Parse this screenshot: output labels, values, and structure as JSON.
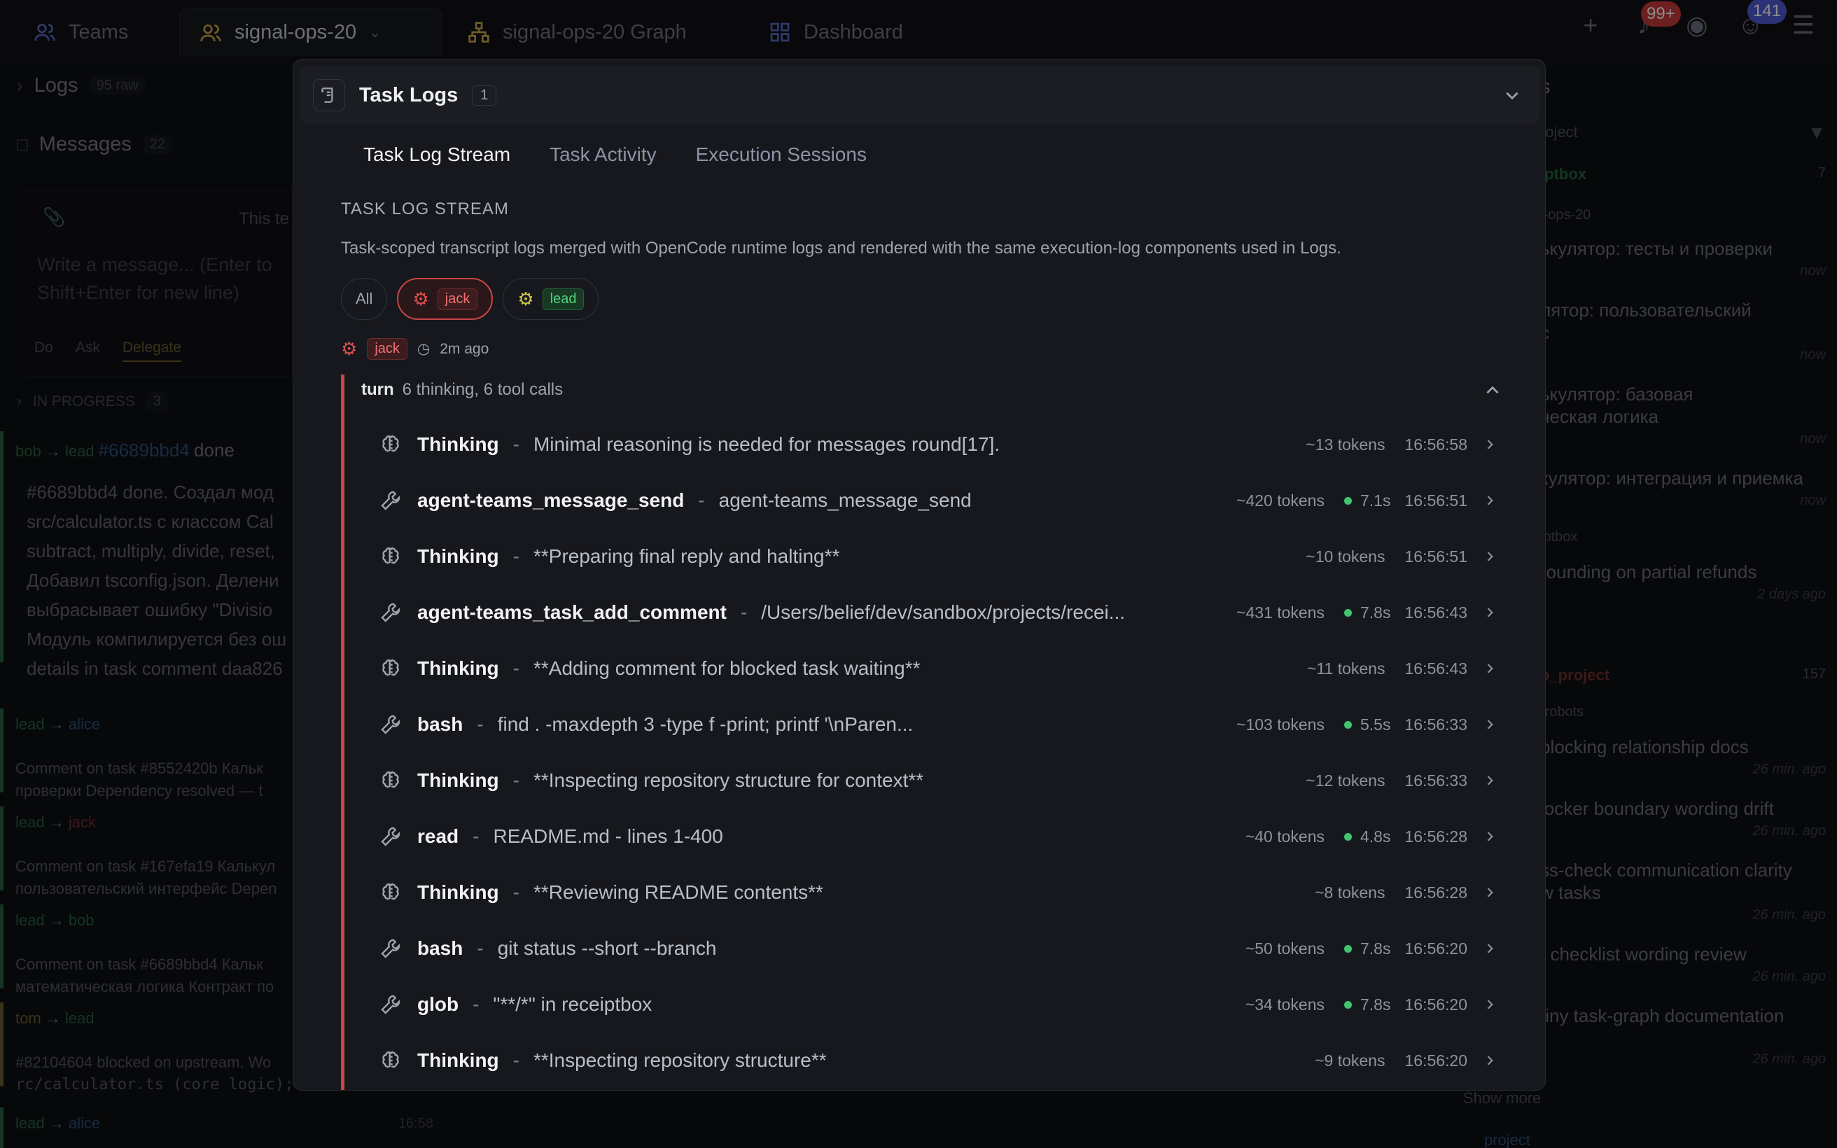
{
  "topbar": {
    "tabs": [
      {
        "label": "Teams",
        "icon": "users-icon"
      },
      {
        "label": "signal-ops-20",
        "icon": "users-icon"
      },
      {
        "label": "signal-ops-20 Graph",
        "icon": "graph-icon"
      },
      {
        "label": "Dashboard",
        "icon": "dashboard-icon"
      }
    ],
    "notifications_badge": "99+",
    "discord_badge": "141"
  },
  "left": {
    "logs_label": "Logs",
    "logs_count": "95 raw",
    "messages_label": "Messages",
    "messages_count": "22",
    "composer_placeholder": "Write a message... (Enter to",
    "composer_placeholder2": "Shift+Enter for new line)",
    "composer_note": "This te",
    "modes": [
      "Do",
      "Ask",
      "Delegate"
    ],
    "in_progress_label": "IN PROGRESS",
    "in_progress_count": "3",
    "feed": [
      {
        "from": "bob",
        "to": "lead",
        "ref": "#6689bbd4",
        "tail": "done"
      },
      {
        "from": "lead",
        "to": "alice"
      },
      {
        "from": "lead",
        "to": "jack"
      },
      {
        "from": "lead",
        "to": "bob"
      },
      {
        "from": "tom",
        "to": "lead"
      },
      {
        "from": "lead",
        "to": "alice"
      }
    ],
    "msg1": [
      "#6689bbd4 done. Создал мод",
      "src/calculator.ts с классом Cal",
      "subtract, multiply, divide, reset,",
      "Добавил tsconfig.json. Делени",
      "выбрасывает ошибку \"Divisio",
      "Модуль компилируется без ош",
      "details in task comment daa826"
    ],
    "c1": [
      "Comment on task #8552420b Кальк",
      "проверки Dependency resolved — t"
    ],
    "c2": [
      "Comment on task #167efa19 Калькул",
      "пользовательский интерфейс Depen"
    ],
    "c3": [
      "Comment on task #6689bbd4 Кальк",
      "математическая логика Контракт по"
    ],
    "c4": [
      "#82104604 blocked on upstream. Wo",
      "rc/calculator.ts (core logic); n"
    ],
    "last_time": "16:58"
  },
  "right": {
    "header_tail": "s",
    "filter": "roject",
    "group1": "iptbox",
    "group1_count": "7",
    "team1": "l-ops-20",
    "items": [
      {
        "text": "ькулятор: тесты и проверки",
        "time": "now"
      },
      {
        "text": "лятор: пользовательский",
        "text2": "с",
        "time": "now"
      },
      {
        "text": "ькулятор: базовая",
        "text2": "ческая логика",
        "time": "now"
      },
      {
        "text": "кулятор: интеграция и приемка",
        "time": "now"
      },
      {
        "text": "rounding on partial refunds",
        "time": "2 days ago"
      }
    ],
    "team2": "iptbox",
    "group2": "o_project",
    "group2_count": "157",
    "team3": "-robots",
    "items2": [
      {
        "text": "blocking relationship docs",
        "time": "26 min. ago"
      },
      {
        "text": "locker boundary wording drift",
        "time": "26 min. ago"
      },
      {
        "text": "ss-check communication clarity",
        "text2": "w tasks",
        "time": "26 min. ago"
      },
      {
        "text": "f checklist wording review",
        "time": "26 min. ago"
      },
      {
        "text": "tiny task-graph documentation",
        "time": "26 min. ago"
      }
    ],
    "show_more": "Show more",
    "project": "project"
  },
  "modal": {
    "title": "Task Logs",
    "count": "1",
    "tabs": [
      "Task Log Stream",
      "Task Activity",
      "Execution Sessions"
    ],
    "section_label": "TASK LOG STREAM",
    "description": "Task-scoped transcript logs merged with OpenCode runtime logs and rendered with the same execution-log components used in Logs.",
    "filters": {
      "all": "All",
      "jack": "jack",
      "lead": "lead"
    },
    "author": {
      "name": "jack",
      "time": "2m ago"
    },
    "turn": {
      "label": "turn",
      "summary": "6 thinking, 6 tool calls"
    },
    "entries": [
      {
        "kind": "thinking",
        "name": "Thinking",
        "detail": "Minimal reasoning is needed for messages round[17].",
        "tokens": "~13 tokens",
        "duration": "",
        "time": "16:56:58"
      },
      {
        "kind": "tool",
        "name": "agent-teams_message_send",
        "detail": "agent-teams_message_send",
        "tokens": "~420 tokens",
        "duration": "7.1s",
        "time": "16:56:51"
      },
      {
        "kind": "thinking",
        "name": "Thinking",
        "detail": "**Preparing final reply and halting**",
        "tokens": "~10 tokens",
        "duration": "",
        "time": "16:56:51"
      },
      {
        "kind": "tool",
        "name": "agent-teams_task_add_comment",
        "detail": "/Users/belief/dev/sandbox/projects/recei...",
        "tokens": "~431 tokens",
        "duration": "7.8s",
        "time": "16:56:43"
      },
      {
        "kind": "thinking",
        "name": "Thinking",
        "detail": "**Adding comment for blocked task waiting**",
        "tokens": "~11 tokens",
        "duration": "",
        "time": "16:56:43"
      },
      {
        "kind": "tool",
        "name": "bash",
        "detail": "find . -maxdepth 3 -type f -print; printf '\\nParen...",
        "tokens": "~103 tokens",
        "duration": "5.5s",
        "time": "16:56:33"
      },
      {
        "kind": "thinking",
        "name": "Thinking",
        "detail": "**Inspecting repository structure for context**",
        "tokens": "~12 tokens",
        "duration": "",
        "time": "16:56:33"
      },
      {
        "kind": "tool",
        "name": "read",
        "detail": "README.md - lines 1-400",
        "tokens": "~40 tokens",
        "duration": "4.8s",
        "time": "16:56:28"
      },
      {
        "kind": "thinking",
        "name": "Thinking",
        "detail": "**Reviewing README contents**",
        "tokens": "~8 tokens",
        "duration": "",
        "time": "16:56:28"
      },
      {
        "kind": "tool",
        "name": "bash",
        "detail": "git status --short --branch",
        "tokens": "~50 tokens",
        "duration": "7.8s",
        "time": "16:56:20"
      },
      {
        "kind": "tool",
        "name": "glob",
        "detail": "\"**/*\" in receiptbox",
        "tokens": "~34 tokens",
        "duration": "7.8s",
        "time": "16:56:20"
      },
      {
        "kind": "thinking",
        "name": "Thinking",
        "detail": "**Inspecting repository structure**",
        "tokens": "~9 tokens",
        "duration": "",
        "time": "16:56:20"
      }
    ]
  }
}
